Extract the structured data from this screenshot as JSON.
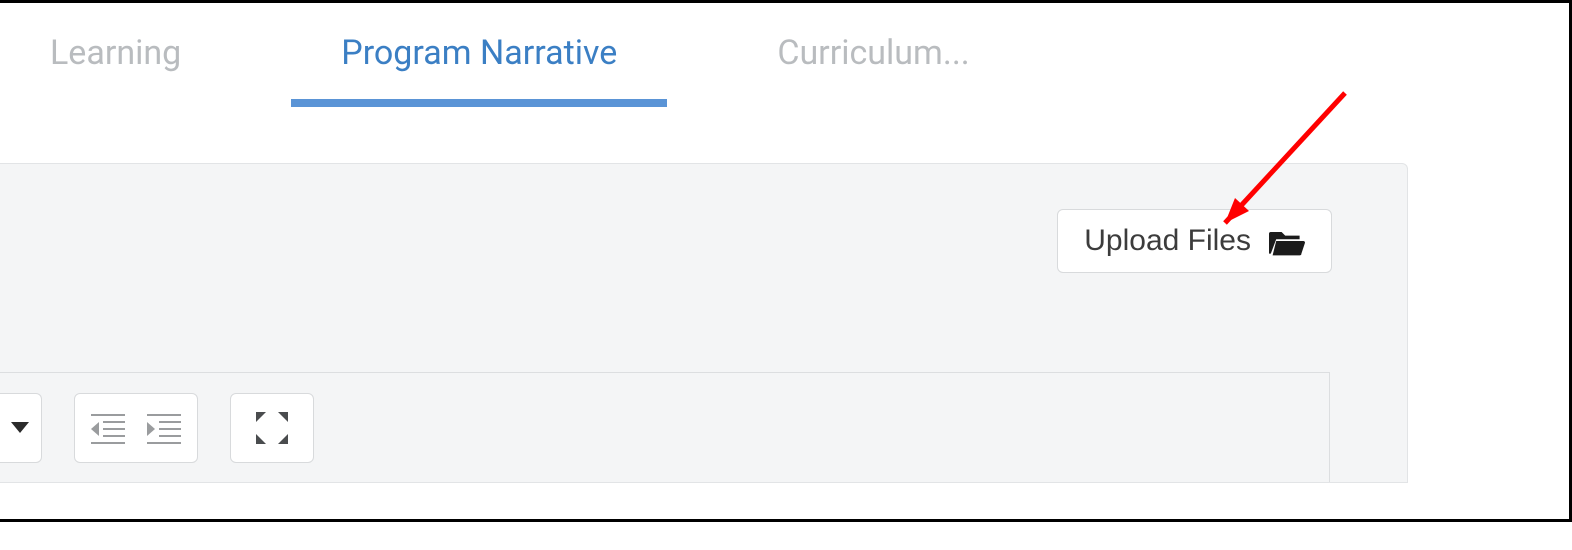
{
  "tabs": {
    "learning": "Learning",
    "program_narrative": "Program Narrative",
    "curriculum": "Curriculum..."
  },
  "upload": {
    "label": "Upload Files"
  }
}
